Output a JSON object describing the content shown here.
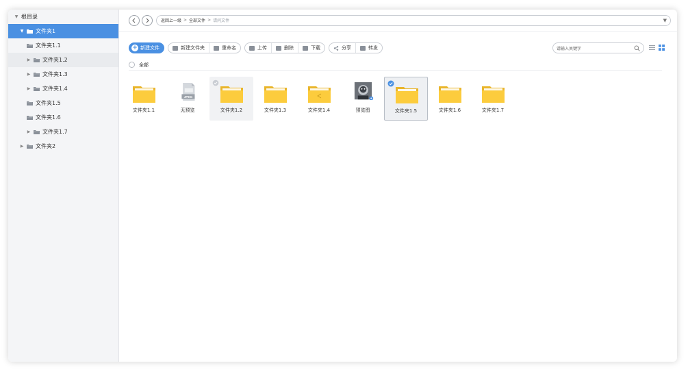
{
  "sidebar": {
    "root_label": "根目录",
    "items": [
      {
        "label": "文件夹1",
        "level": 1,
        "expanded": true,
        "active": true
      },
      {
        "label": "文件夹1.1",
        "level": 2,
        "hasChildren": false
      },
      {
        "label": "文件夹1.2",
        "level": 2,
        "hasChildren": true,
        "hover": true
      },
      {
        "label": "文件夹1.3",
        "level": 2,
        "hasChildren": true
      },
      {
        "label": "文件夹1.4",
        "level": 2,
        "hasChildren": true
      },
      {
        "label": "文件夹1.5",
        "level": 2,
        "hasChildren": false
      },
      {
        "label": "文件夹1.6",
        "level": 2,
        "hasChildren": false
      },
      {
        "label": "文件夹1.7",
        "level": 2,
        "hasChildren": true
      },
      {
        "label": "文件夹2",
        "level": 1,
        "hasChildren": true
      }
    ]
  },
  "navbar": {
    "back_icon": "chevron-left-icon",
    "forward_icon": "chevron-right-icon",
    "path": [
      "返回上一级",
      "全部文件",
      "请问文件"
    ],
    "separator": ">"
  },
  "toolbar": {
    "primary_label": "新建文件",
    "group1": [
      "新建文件夹",
      "重命名"
    ],
    "group2": [
      "上传",
      "删除",
      "下载"
    ],
    "group3": [
      "分享",
      "转发"
    ],
    "search_placeholder": "请输入关键字"
  },
  "select_all_label": "全部",
  "files": [
    {
      "name": "文件夹1.1",
      "type": "folder"
    },
    {
      "name": "无预览",
      "type": "jpeg",
      "badge": "JPEG"
    },
    {
      "name": "文件夹1.2",
      "type": "folder",
      "state": "hover"
    },
    {
      "name": "文件夹1.3",
      "type": "folder"
    },
    {
      "name": "文件夹1.4",
      "type": "folder-shared"
    },
    {
      "name": "预览图",
      "type": "image"
    },
    {
      "name": "文件夹1.5",
      "type": "folder",
      "state": "selected"
    },
    {
      "name": "文件夹1.6",
      "type": "folder"
    },
    {
      "name": "文件夹1.7",
      "type": "folder"
    }
  ],
  "colors": {
    "accent": "#4a90e2",
    "folder": "#fccc3d",
    "folder_tab": "#e9b52b"
  }
}
